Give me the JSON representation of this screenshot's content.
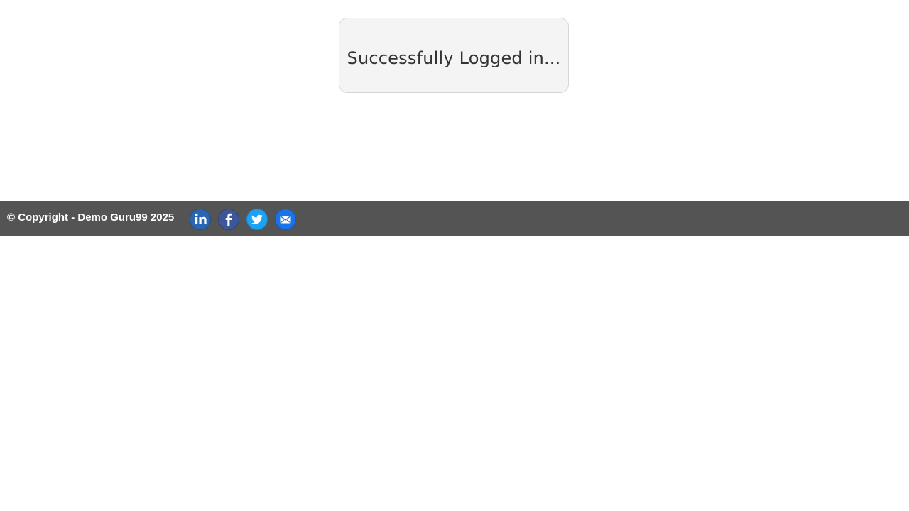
{
  "message": {
    "text": "Successfully Logged in..."
  },
  "footer": {
    "copyright": "© Copyright - Demo Guru99 2025",
    "social": [
      {
        "name": "linkedin-icon",
        "color": "#2a67b3"
      },
      {
        "name": "facebook-icon",
        "color": "#3b5798"
      },
      {
        "name": "twitter-icon",
        "color": "#1da1f2"
      },
      {
        "name": "email-icon",
        "color": "#1a73e8"
      }
    ]
  },
  "colors": {
    "footer_bg": "#545454",
    "box_bg": "#f4f4f4",
    "box_border": "#d6d6d6",
    "text": "#333333"
  }
}
